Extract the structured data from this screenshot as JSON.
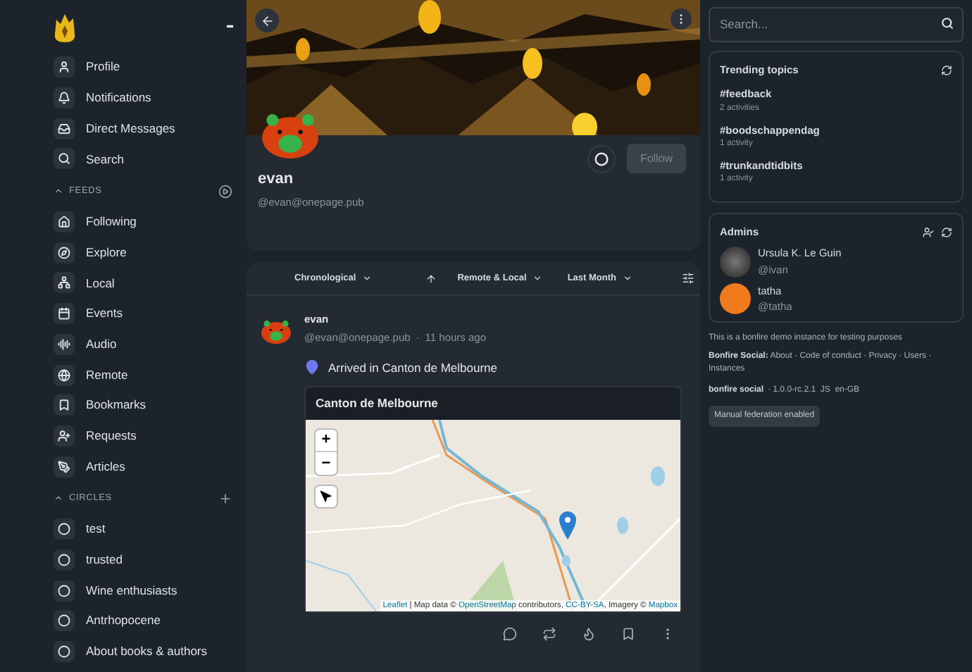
{
  "sidebar": {
    "menu_button": "•••",
    "items": [
      {
        "label": "Profile"
      },
      {
        "label": "Notifications"
      },
      {
        "label": "Direct Messages"
      },
      {
        "label": "Search"
      }
    ],
    "sections": [
      {
        "title": "FEEDS",
        "items": [
          {
            "label": "Following"
          },
          {
            "label": "Explore"
          },
          {
            "label": "Local"
          },
          {
            "label": "Events"
          },
          {
            "label": "Audio"
          },
          {
            "label": "Remote"
          },
          {
            "label": "Bookmarks"
          },
          {
            "label": "Requests"
          },
          {
            "label": "Articles"
          }
        ]
      },
      {
        "title": "CIRCLES",
        "items": [
          {
            "label": "test"
          },
          {
            "label": "trusted"
          },
          {
            "label": "Wine enthusiasts"
          },
          {
            "label": "Antrhopocene"
          },
          {
            "label": "About books & authors"
          }
        ]
      }
    ]
  },
  "profile": {
    "name": "evan",
    "handle": "@evan@onepage.pub",
    "follow_button": "Follow",
    "follow_disabled": true
  },
  "filters": [
    {
      "label": "Chronological",
      "kind": "dropdown"
    },
    {
      "kind": "sort"
    },
    {
      "label": "Remote & Local",
      "kind": "dropdown"
    },
    {
      "label": "Last Month",
      "kind": "dropdown"
    },
    {
      "kind": "settings"
    }
  ],
  "post": {
    "author": "evan",
    "handle": "@evan@onepage.pub",
    "time": "11 hours ago",
    "separator": "·",
    "location": "Arrived in Canton de Melbourne",
    "map": {
      "title": "Canton de Melbourne",
      "zoom_in": "+",
      "zoom_out": "−",
      "attribution": [
        {
          "text": "Leaflet",
          "link": true
        },
        {
          "text": " | Map data © ",
          "link": false
        },
        {
          "text": "OpenStreetMap",
          "link": true
        },
        {
          "text": " contributors, ",
          "link": false
        },
        {
          "text": "CC-BY-SA",
          "link": true
        },
        {
          "text": ", Imagery © ",
          "link": false
        },
        {
          "text": "Mapbox",
          "link": true
        }
      ]
    }
  },
  "search": {
    "placeholder": "Search..."
  },
  "trending": {
    "title": "Trending topics",
    "topics": [
      {
        "tag": "#feedback",
        "count": "2 activities"
      },
      {
        "tag": "#boodschappendag",
        "count": "1 activity"
      },
      {
        "tag": "#trunkandtidbits",
        "count": "1 activity"
      }
    ]
  },
  "admins": {
    "title": "Admins",
    "people": [
      {
        "name": "Ursula K. Le Guin",
        "handle": "@ivan"
      },
      {
        "name": "tatha",
        "handle": "@tatha"
      }
    ]
  },
  "about": "This is a bonfire demo instance for testing purposes",
  "footer_links": {
    "label": "Bonfire Social:",
    "separator": "·",
    "links": [
      "About",
      "Code of conduct",
      "Privacy",
      "Users",
      "Instances"
    ]
  },
  "version": {
    "label": "bonfire social",
    "text": "· 1.0.0-rc.2.1  JS  en-GB"
  },
  "badge": "Manual federation enabled"
}
